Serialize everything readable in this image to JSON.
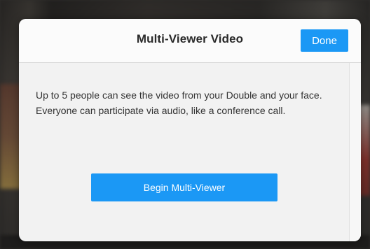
{
  "modal": {
    "title": "Multi-Viewer Video",
    "done_label": "Done",
    "description": "Up to 5 people can see the video from your Double and your face. Everyone can participate via audio, like a conference call.",
    "begin_label": "Begin Multi-Viewer"
  },
  "colors": {
    "accent": "#1b98f5",
    "modal_bg": "#f2f2f2",
    "header_bg": "#fbfbfb",
    "title_text": "#2a2a2a",
    "body_text": "#333333"
  }
}
